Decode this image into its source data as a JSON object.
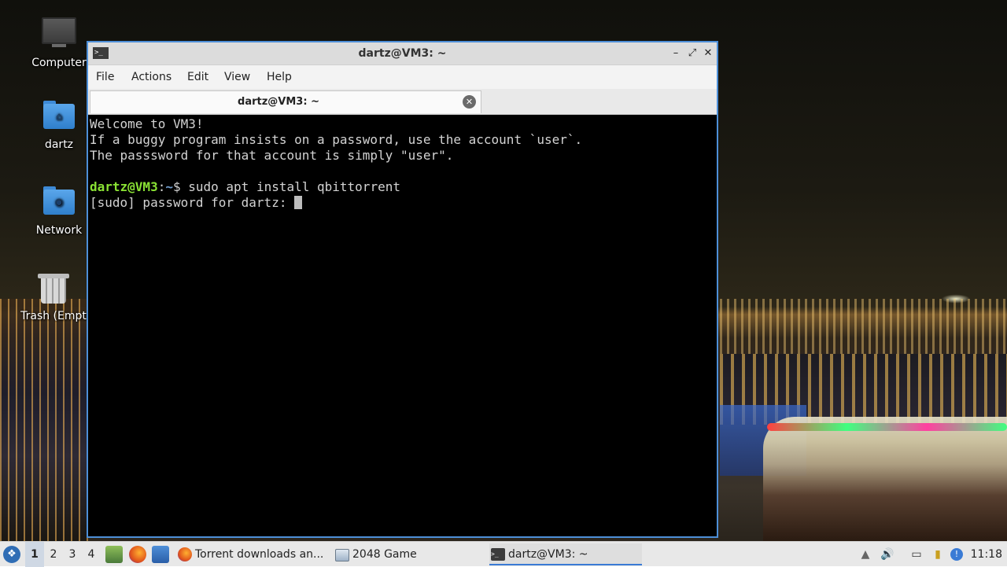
{
  "desktop": {
    "icons": [
      {
        "label": "Computer",
        "icon": "monitor-icon"
      },
      {
        "label": "dartz",
        "icon": "home-folder-icon"
      },
      {
        "label": "Network",
        "icon": "network-folder-icon"
      },
      {
        "label": "Trash (Empt",
        "icon": "trash-icon"
      }
    ]
  },
  "window": {
    "title": "dartz@VM3: ~",
    "menu": [
      "File",
      "Actions",
      "Edit",
      "View",
      "Help"
    ],
    "tab_label": "dartz@VM3: ~",
    "terminal": {
      "lines": [
        "Welcome to VM3!",
        "If a buggy program insists on a password, use the account `user`.",
        "The passsword for that account is simply \"user\".",
        ""
      ],
      "prompt_user": "dartz@VM3",
      "prompt_sep": ":",
      "prompt_path": "~",
      "prompt_symbol": "$ ",
      "command": "sudo apt install qbittorrent",
      "sudo_prompt": "[sudo] password for dartz: "
    }
  },
  "taskbar": {
    "workspaces": [
      "1",
      "2",
      "3",
      "4"
    ],
    "active_workspace": "1",
    "tasks": [
      {
        "label": "Torrent downloads an...",
        "icon": "firefox-icon"
      },
      {
        "label": "2048 Game",
        "icon": "window-icon"
      },
      {
        "label": "dartz@VM3: ~",
        "icon": "terminal-icon"
      }
    ],
    "clock": "11:18"
  },
  "colors": {
    "window_border": "#4d8fd8",
    "terminal_bg": "#000000",
    "prompt_user": "#8ae234",
    "prompt_path": "#729fcf"
  }
}
